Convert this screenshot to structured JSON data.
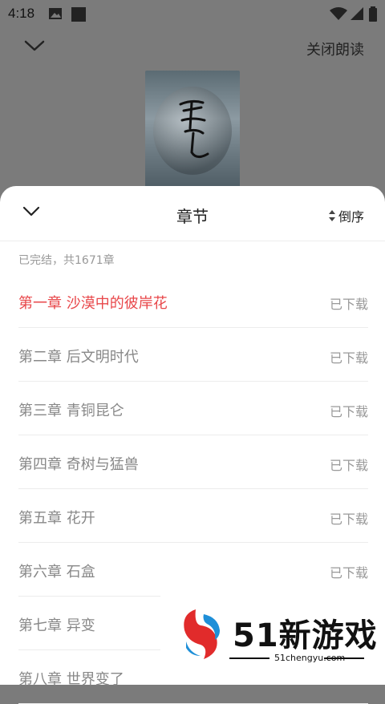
{
  "status_bar": {
    "time": "4:18"
  },
  "reader": {
    "close_label": "关闭朗读"
  },
  "sheet": {
    "title": "章节",
    "sort_label": "倒序",
    "summary": "已完结，共1671章",
    "chapters": [
      {
        "name": "第一章 沙漠中的彼岸花",
        "status": "已下载",
        "active": true
      },
      {
        "name": "第二章 后文明时代",
        "status": "已下载"
      },
      {
        "name": "第三章 青铜昆仑",
        "status": "已下载"
      },
      {
        "name": "第四章 奇树与猛兽",
        "status": "已下载"
      },
      {
        "name": "第五章 花开",
        "status": "已下载"
      },
      {
        "name": "第六章 石盒",
        "status": "已下载"
      },
      {
        "name": "第七章 异变",
        "status": ""
      },
      {
        "name": "第八章 世界变了",
        "status": ""
      }
    ]
  },
  "watermark": {
    "brand": "51新游戏",
    "url": "51chengyu.com"
  },
  "colors": {
    "active_chapter": "#e8474a",
    "overlay": "#7b7b7b"
  }
}
